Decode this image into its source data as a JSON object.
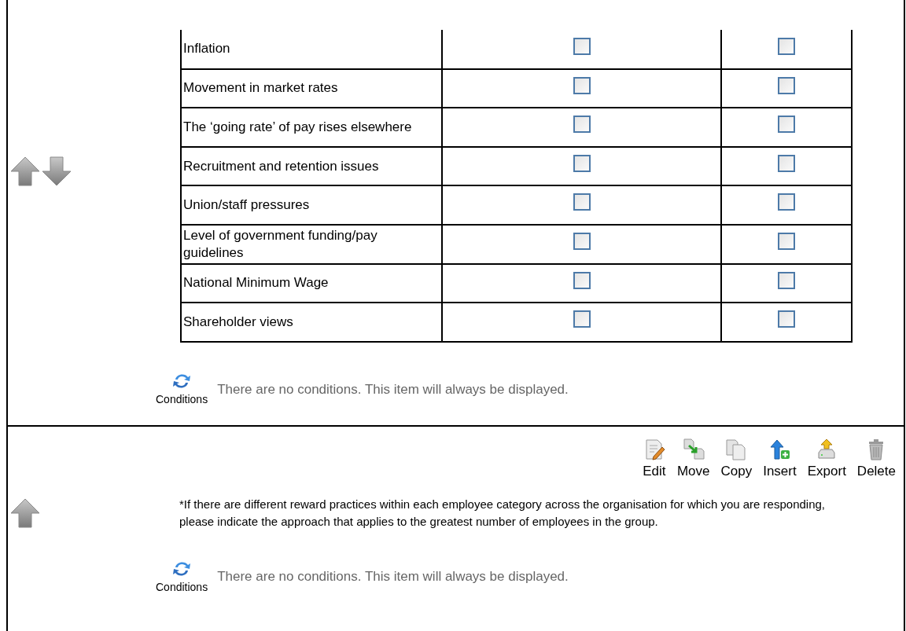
{
  "question_item": {
    "can_move_up": true,
    "can_move_down": true,
    "rows": [
      {
        "label": "Inflation",
        "col_1_checked": false,
        "col_2_checked": false
      },
      {
        "label": "Movement in market rates",
        "col_1_checked": false,
        "col_2_checked": false
      },
      {
        "label": "The ‘going rate’ of pay rises elsewhere",
        "col_1_checked": false,
        "col_2_checked": false
      },
      {
        "label": "Recruitment and retention issues",
        "col_1_checked": false,
        "col_2_checked": false
      },
      {
        "label": "Union/staff pressures",
        "col_1_checked": false,
        "col_2_checked": false
      },
      {
        "label": "Level of government funding/pay guidelines",
        "col_1_checked": false,
        "col_2_checked": false
      },
      {
        "label": "National Minimum Wage",
        "col_1_checked": false,
        "col_2_checked": false
      },
      {
        "label": "Shareholder views",
        "col_1_checked": false,
        "col_2_checked": false
      }
    ],
    "conditions": {
      "label": "Conditions",
      "message": "There are no conditions. This item will always be displayed."
    }
  },
  "text_item": {
    "toolbar": [
      {
        "kind": "edit",
        "label": "Edit"
      },
      {
        "kind": "move",
        "label": "Move"
      },
      {
        "kind": "copy",
        "label": "Copy"
      },
      {
        "kind": "insert",
        "label": "Insert"
      },
      {
        "kind": "export",
        "label": "Export"
      },
      {
        "kind": "delete",
        "label": "Delete"
      }
    ],
    "can_move_up": true,
    "can_move_down": false,
    "note": "*If there are different reward practices within each employee category across the organisation for which you are responding, please indicate the approach that applies to the greatest number of employees in the group.",
    "conditions": {
      "label": "Conditions",
      "message": "There are no conditions. This item will always be displayed."
    }
  }
}
